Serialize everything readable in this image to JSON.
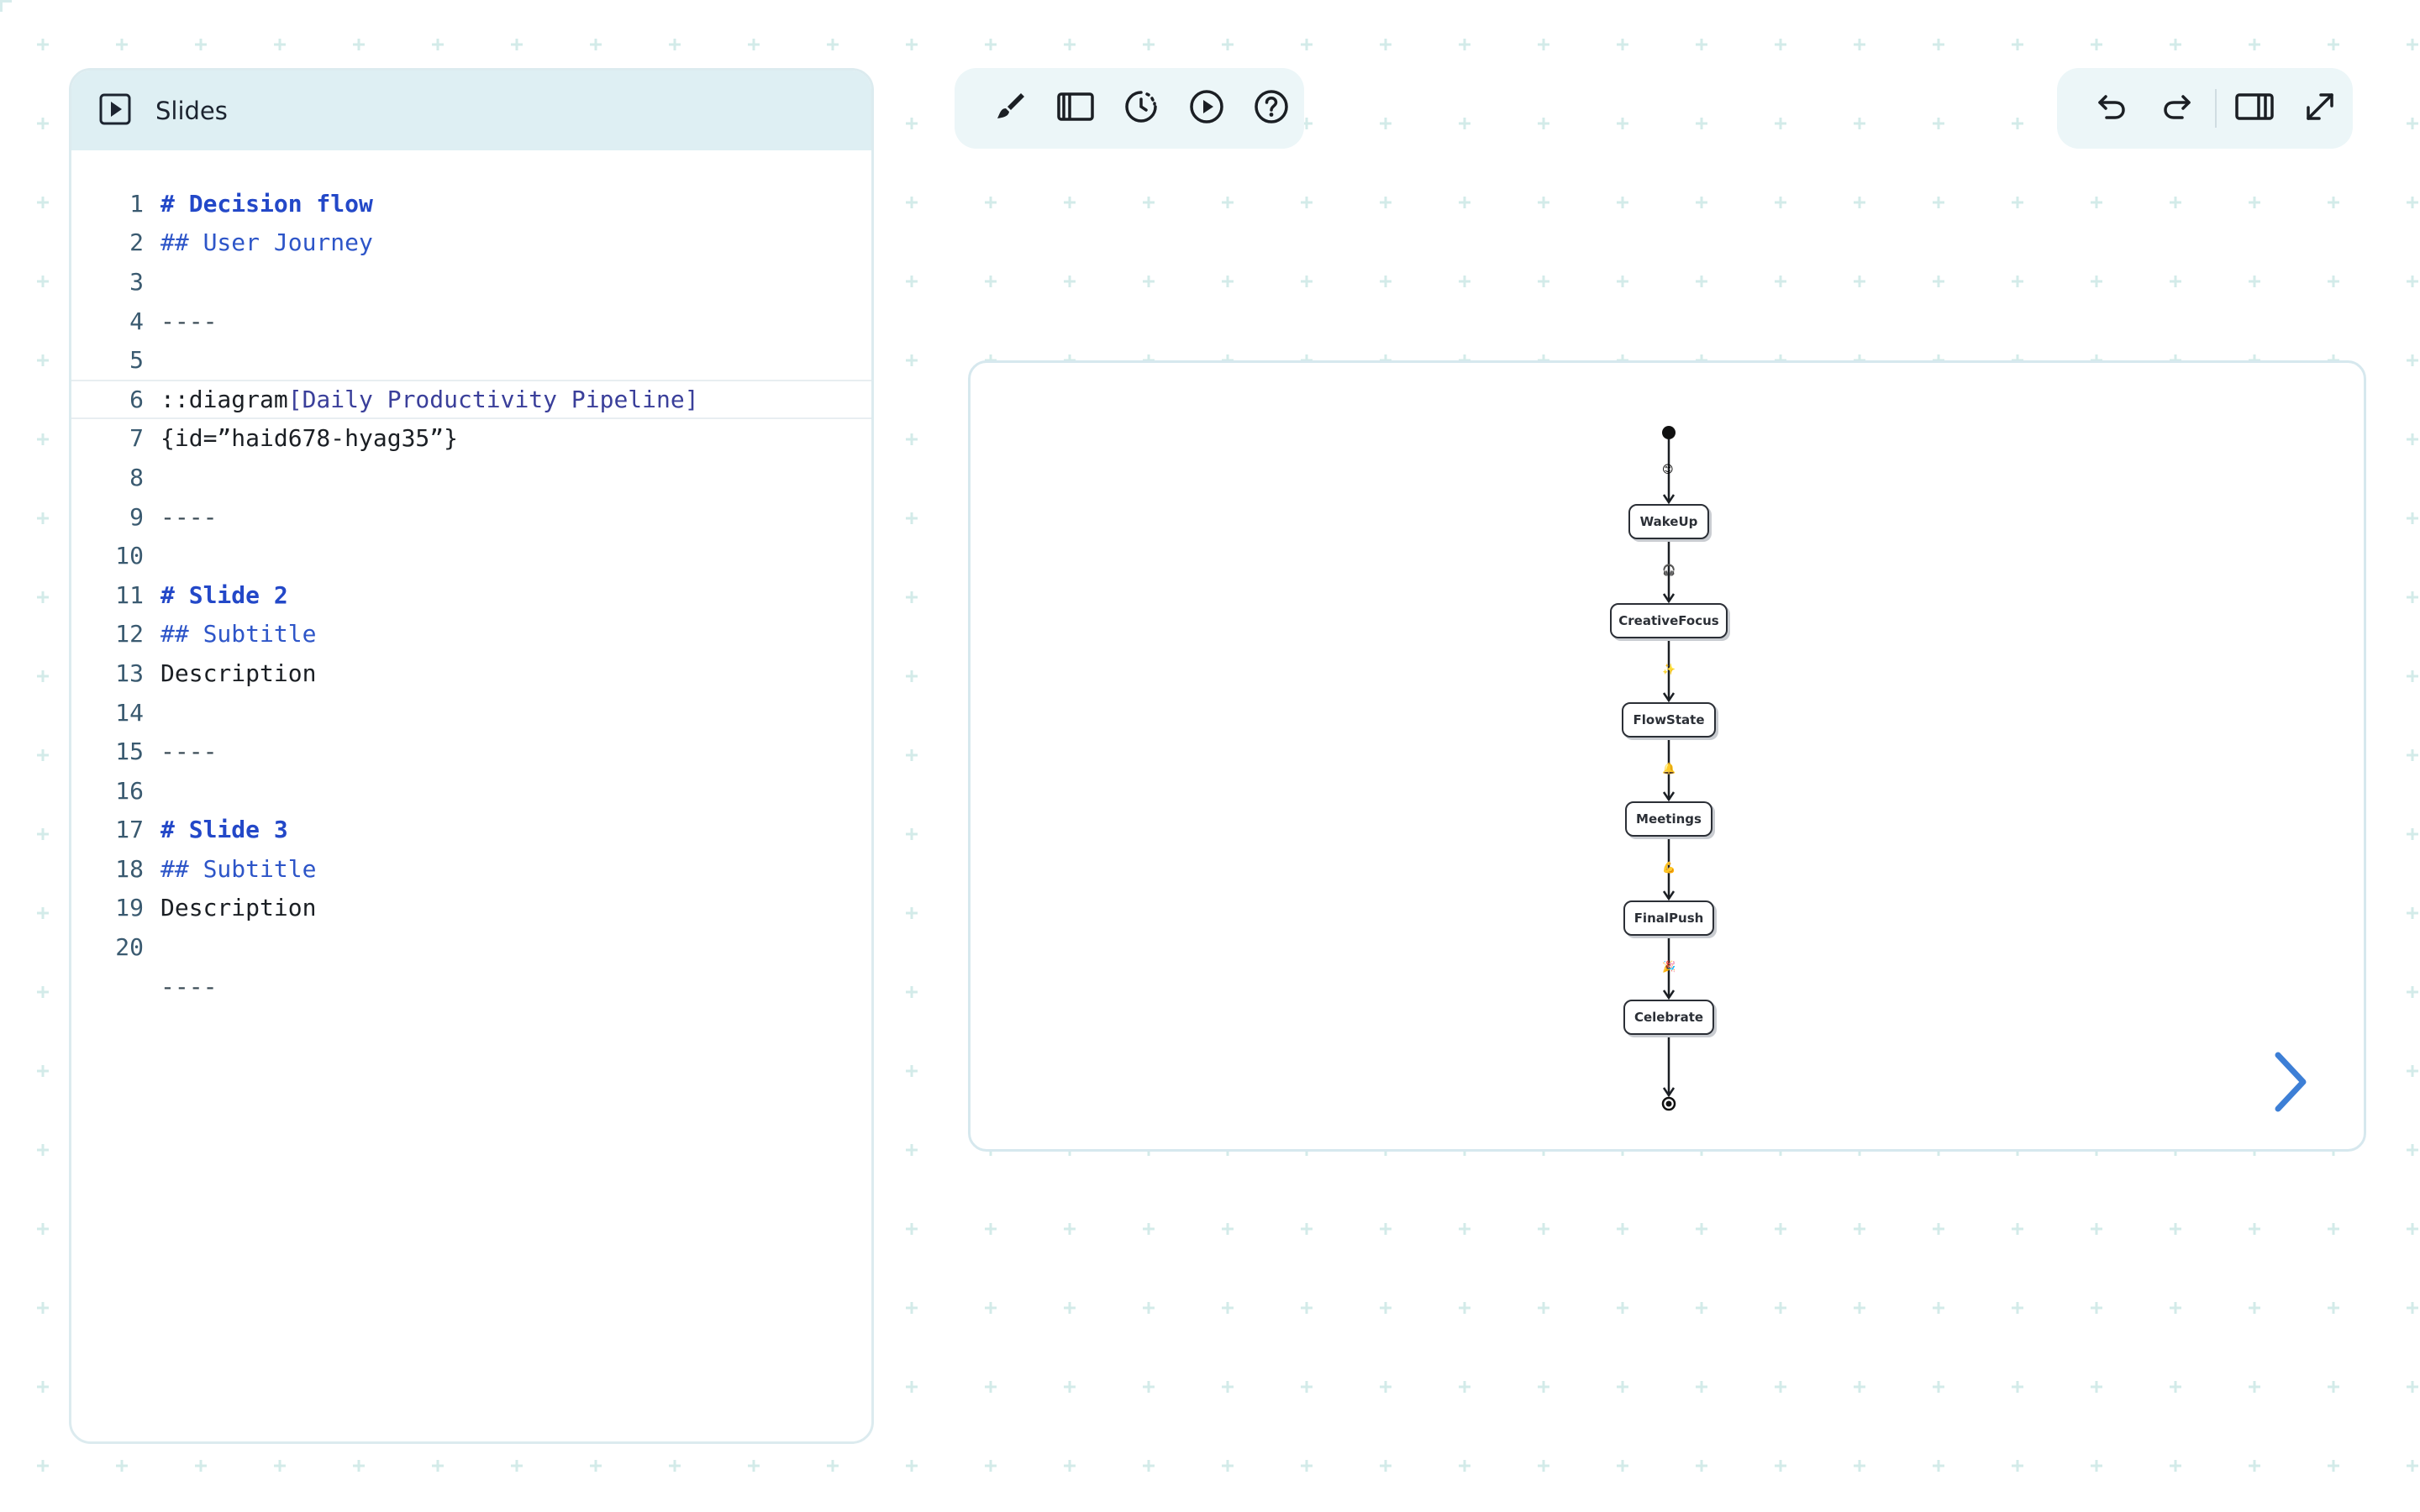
{
  "editor": {
    "title": "Slides",
    "icon": "play-square-icon",
    "lines": [
      {
        "n": "1",
        "parts": [
          {
            "t": "# Decision flow",
            "c": "h1"
          }
        ]
      },
      {
        "n": "2",
        "parts": [
          {
            "t": "## User Journey",
            "c": "h2"
          }
        ]
      },
      {
        "n": "3",
        "parts": []
      },
      {
        "n": "4",
        "parts": [
          {
            "t": "----",
            "c": "dash"
          }
        ]
      },
      {
        "n": "5",
        "parts": []
      },
      {
        "n": "6",
        "parts": [
          {
            "t": "::diagram",
            "c": "plain"
          },
          {
            "t": "[Daily Productivity Pipeline]",
            "c": "br"
          }
        ],
        "active": true
      },
      {
        "n": "7",
        "parts": [
          {
            "t": "{id=”haid678-hyag35”}",
            "c": "plain"
          }
        ]
      },
      {
        "n": "8",
        "parts": []
      },
      {
        "n": "9",
        "parts": [
          {
            "t": "----",
            "c": "dash"
          }
        ]
      },
      {
        "n": "10",
        "parts": []
      },
      {
        "n": "11",
        "parts": [
          {
            "t": "# Slide 2",
            "c": "h1"
          }
        ]
      },
      {
        "n": "12",
        "parts": [
          {
            "t": "## Subtitle",
            "c": "h2"
          }
        ]
      },
      {
        "n": "13",
        "parts": [
          {
            "t": "Description",
            "c": "plain"
          }
        ]
      },
      {
        "n": "14",
        "parts": []
      },
      {
        "n": "15",
        "parts": [
          {
            "t": "----",
            "c": "dash"
          }
        ]
      },
      {
        "n": "16",
        "parts": []
      },
      {
        "n": "17",
        "parts": [
          {
            "t": "# Slide 3",
            "c": "h1"
          }
        ]
      },
      {
        "n": "18",
        "parts": [
          {
            "t": "## Subtitle",
            "c": "h2"
          }
        ]
      },
      {
        "n": "19",
        "parts": [
          {
            "t": "Description",
            "c": "plain"
          }
        ]
      },
      {
        "n": "20",
        "parts": []
      },
      {
        "n": "",
        "parts": [
          {
            "t": "----",
            "c": "dash"
          }
        ]
      }
    ]
  },
  "toolbar_left": [
    {
      "name": "brush-icon"
    },
    {
      "name": "sidebar-panel-icon"
    },
    {
      "name": "timer-icon"
    },
    {
      "name": "play-circle-icon"
    },
    {
      "name": "help-icon"
    }
  ],
  "toolbar_right": [
    {
      "name": "undo-icon"
    },
    {
      "name": "redo-icon"
    },
    {
      "name": "layout-split-icon"
    },
    {
      "name": "expand-icon"
    }
  ],
  "diagram": {
    "nodes": [
      {
        "id": "wakeup",
        "label": "WakeUp",
        "emoji": "😊"
      },
      {
        "id": "creativefocus",
        "label": "CreativeFocus",
        "emoji": "🎧"
      },
      {
        "id": "flowstate",
        "label": "FlowState",
        "emoji": "✨"
      },
      {
        "id": "meetings",
        "label": "Meetings",
        "emoji": "🔔"
      },
      {
        "id": "finalpush",
        "label": "FinalPush",
        "emoji": "💪"
      },
      {
        "id": "celebrate",
        "label": "Celebrate",
        "emoji": "🎉"
      }
    ],
    "start_emoji": "😊"
  },
  "colors": {
    "accent": "#3d7fd6",
    "heading": "#2348c8",
    "panel_header": "#deeff3"
  }
}
